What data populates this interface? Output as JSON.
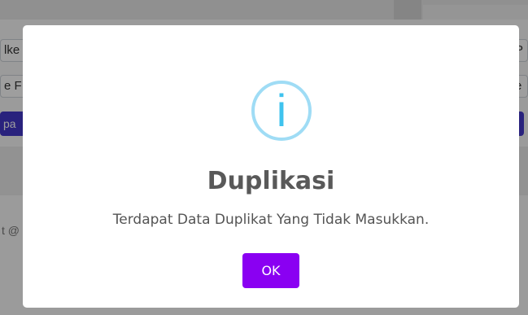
{
  "background": {
    "field_1_fragment_left": "lke",
    "field_1_fragment_right": "P",
    "field_2_fragment_left": "e F",
    "field_2_fragment_right": "e",
    "button_fragment": "pa",
    "footer_fragment": "t @"
  },
  "dialog": {
    "icon": "info-icon",
    "icon_glyph": "i",
    "title": "Duplikasi",
    "message": "Terdapat Data Duplikat Yang Tidak Masukkan.",
    "confirm_label": "OK",
    "colors": {
      "icon_ring": "#9fdcf5",
      "icon_glyph": "#3fc3ee",
      "confirm_button": "#8a00f2"
    }
  }
}
